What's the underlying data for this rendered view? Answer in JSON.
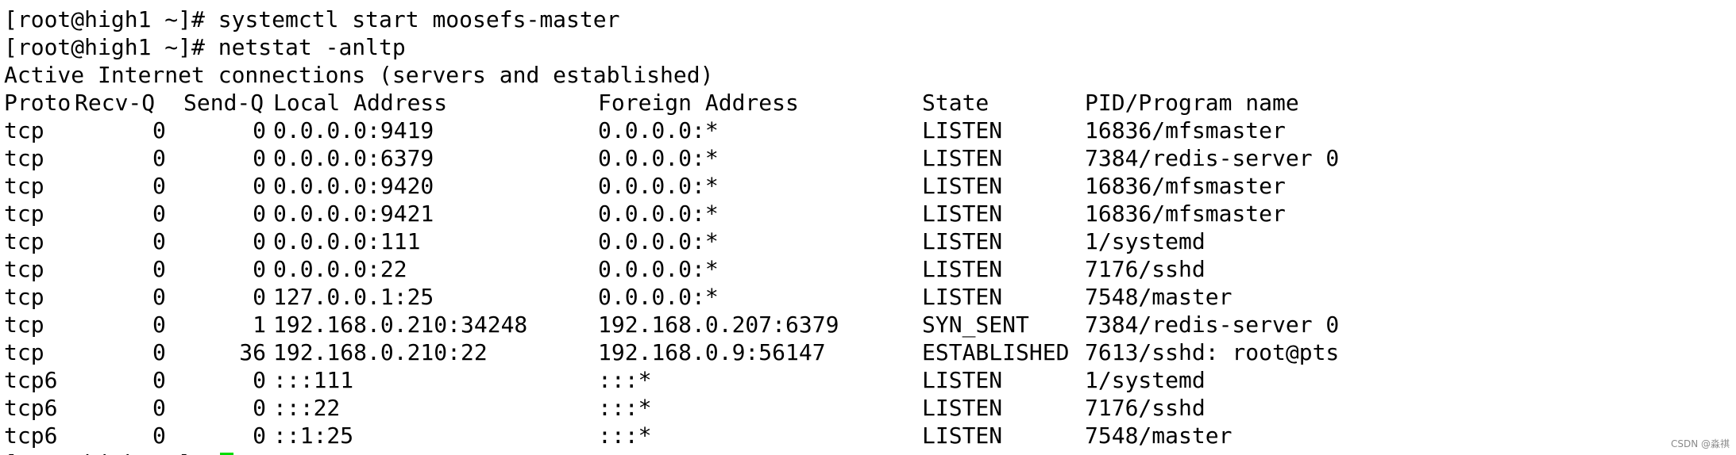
{
  "terminal": {
    "prompt": "[root@high1 ~]#",
    "commands": [
      "systemctl start moosefs-master",
      "netstat -anltp"
    ],
    "intro": "Active Internet connections (servers and established)",
    "headers": {
      "proto": "Proto",
      "recv": "Recv-Q",
      "send": "Send-Q",
      "local": "Local Address",
      "foreign": "Foreign Address",
      "state": "State",
      "pid": "PID/Program name"
    },
    "rows": [
      {
        "proto": "tcp",
        "recv": "0",
        "send": "0",
        "local": "0.0.0.0:9419",
        "foreign": "0.0.0.0:*",
        "state": "LISTEN",
        "pid": "16836/mfsmaster"
      },
      {
        "proto": "tcp",
        "recv": "0",
        "send": "0",
        "local": "0.0.0.0:6379",
        "foreign": "0.0.0.0:*",
        "state": "LISTEN",
        "pid": "7384/redis-server 0"
      },
      {
        "proto": "tcp",
        "recv": "0",
        "send": "0",
        "local": "0.0.0.0:9420",
        "foreign": "0.0.0.0:*",
        "state": "LISTEN",
        "pid": "16836/mfsmaster"
      },
      {
        "proto": "tcp",
        "recv": "0",
        "send": "0",
        "local": "0.0.0.0:9421",
        "foreign": "0.0.0.0:*",
        "state": "LISTEN",
        "pid": "16836/mfsmaster"
      },
      {
        "proto": "tcp",
        "recv": "0",
        "send": "0",
        "local": "0.0.0.0:111",
        "foreign": "0.0.0.0:*",
        "state": "LISTEN",
        "pid": "1/systemd"
      },
      {
        "proto": "tcp",
        "recv": "0",
        "send": "0",
        "local": "0.0.0.0:22",
        "foreign": "0.0.0.0:*",
        "state": "LISTEN",
        "pid": "7176/sshd"
      },
      {
        "proto": "tcp",
        "recv": "0",
        "send": "0",
        "local": "127.0.0.1:25",
        "foreign": "0.0.0.0:*",
        "state": "LISTEN",
        "pid": "7548/master"
      },
      {
        "proto": "tcp",
        "recv": "0",
        "send": "1",
        "local": "192.168.0.210:34248",
        "foreign": "192.168.0.207:6379",
        "state": "SYN_SENT",
        "pid": "7384/redis-server 0"
      },
      {
        "proto": "tcp",
        "recv": "0",
        "send": "36",
        "local": "192.168.0.210:22",
        "foreign": "192.168.0.9:56147",
        "state": "ESTABLISHED",
        "pid": "7613/sshd: root@pts"
      },
      {
        "proto": "tcp6",
        "recv": "0",
        "send": "0",
        "local": ":::111",
        "foreign": ":::*",
        "state": "LISTEN",
        "pid": "1/systemd"
      },
      {
        "proto": "tcp6",
        "recv": "0",
        "send": "0",
        "local": ":::22",
        "foreign": ":::*",
        "state": "LISTEN",
        "pid": "7176/sshd"
      },
      {
        "proto": "tcp6",
        "recv": "0",
        "send": "0",
        "local": "::1:25",
        "foreign": ":::*",
        "state": "LISTEN",
        "pid": "7548/master"
      }
    ]
  },
  "colors": {
    "background": "#ffffff",
    "text": "#000000",
    "cursor": "#00dd00"
  },
  "watermark": "CSDN @淼祺"
}
